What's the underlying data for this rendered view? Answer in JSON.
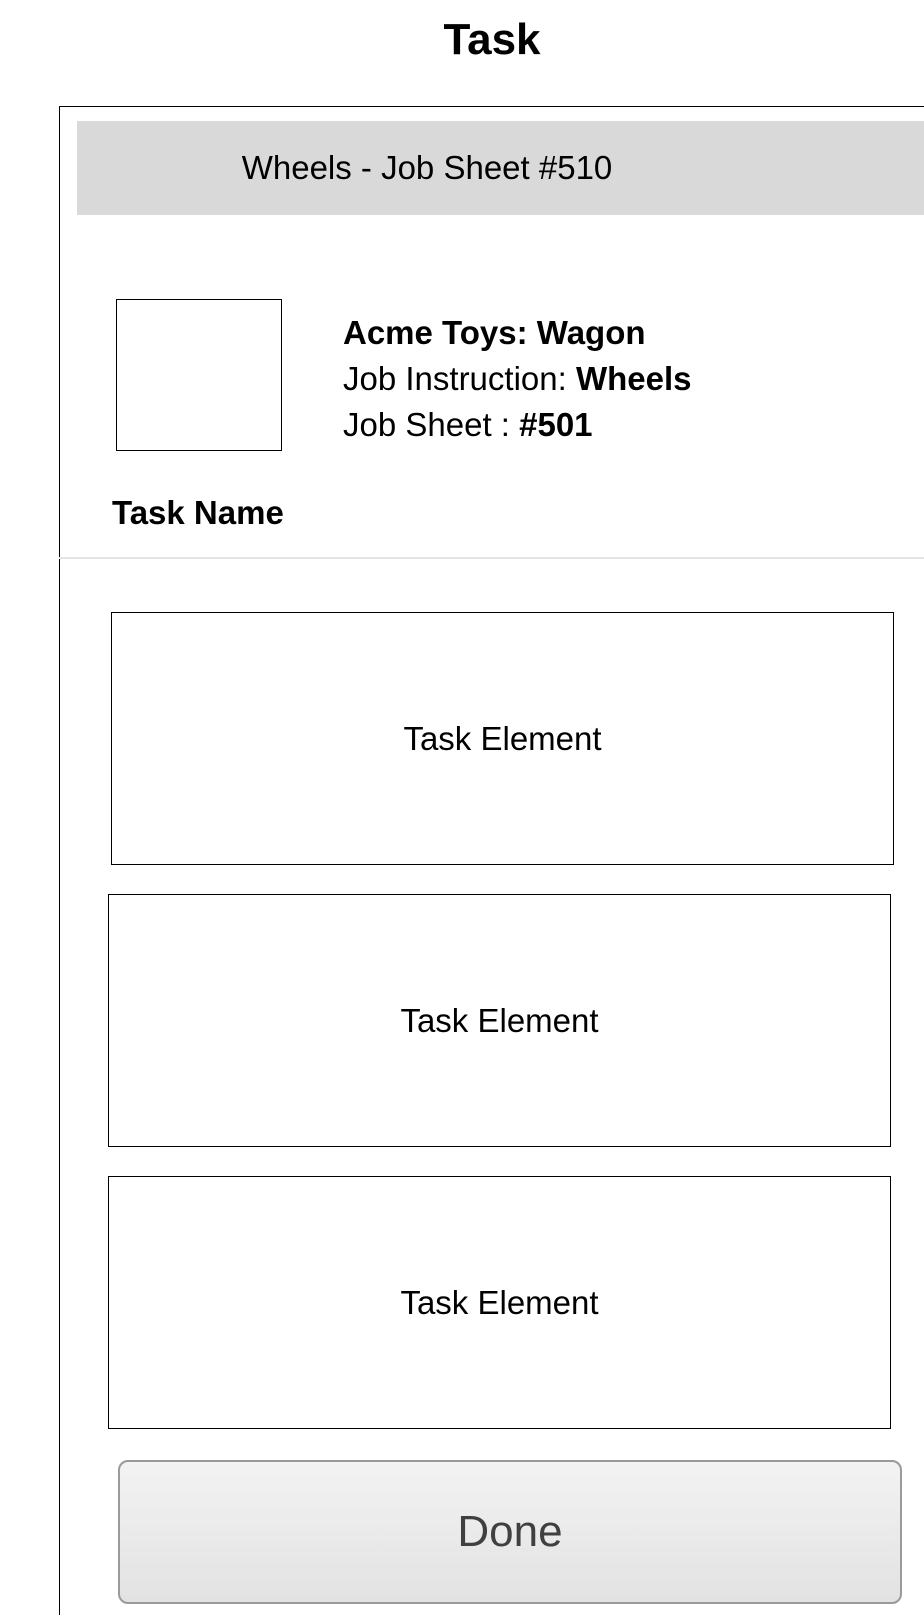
{
  "page": {
    "title": "Task"
  },
  "header": {
    "title": "Wheels - Job Sheet #510"
  },
  "job": {
    "product": "Acme Toys: Wagon",
    "instruction_label": "Job Instruction: ",
    "instruction_value": "Wheels",
    "sheet_label": "Job Sheet : ",
    "sheet_value": "#501"
  },
  "task": {
    "name_label": "Task Name",
    "elements": [
      {
        "label": "Task Element"
      },
      {
        "label": "Task Element"
      },
      {
        "label": "Task Element"
      }
    ]
  },
  "actions": {
    "done_label": "Done"
  },
  "colors": {
    "header_bar": "#d9d9d9",
    "button_text": "#404040",
    "button_border": "#9a9a9a"
  }
}
